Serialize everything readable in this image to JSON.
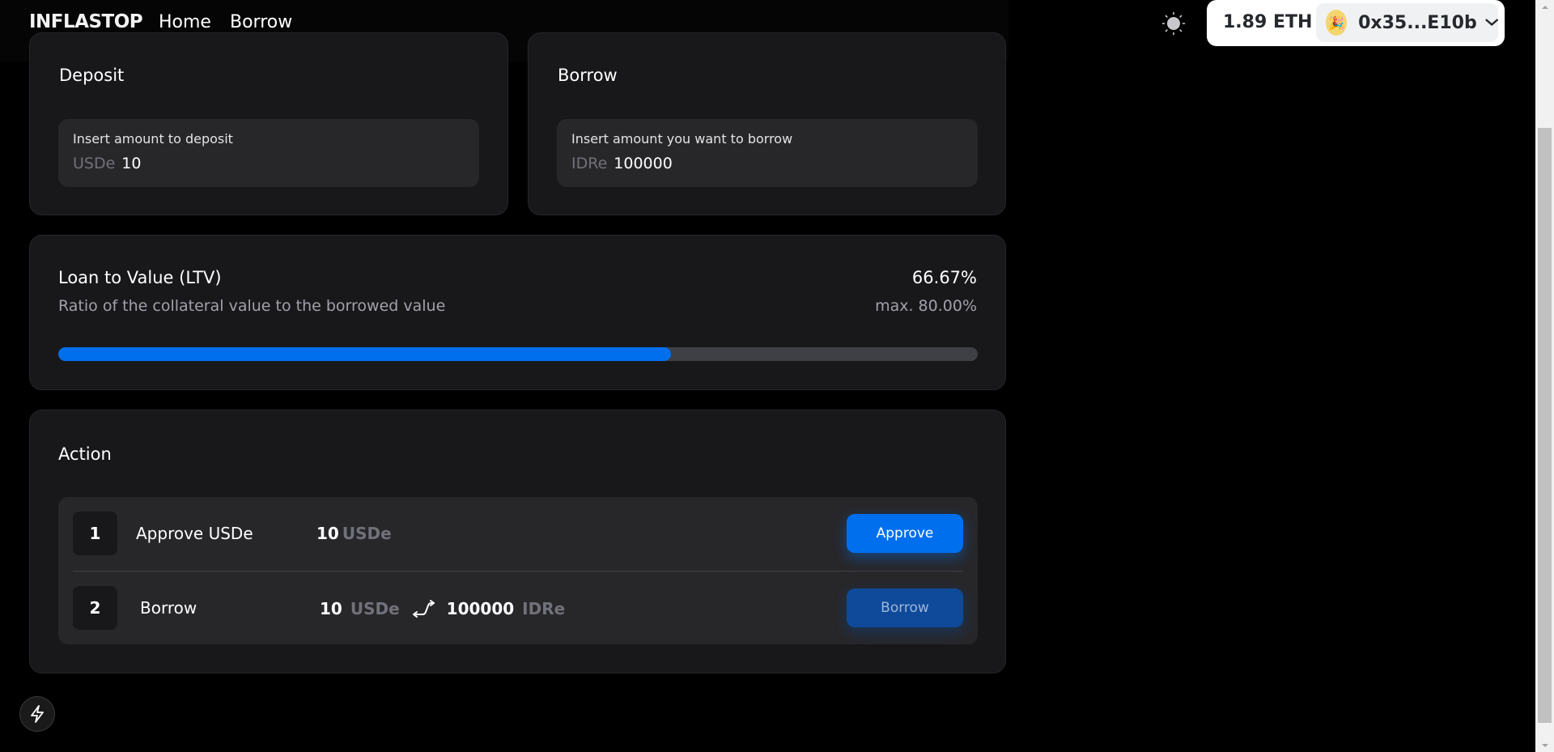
{
  "navbar": {
    "brand": "INFLASTOP",
    "links": [
      {
        "label": "Home"
      },
      {
        "label": "Borrow"
      }
    ]
  },
  "wallet": {
    "balance": "1.89 ETH",
    "address": "0x35...E10b",
    "avatar_emoji": "🎉"
  },
  "deposit": {
    "title": "Deposit",
    "label": "Insert amount to deposit",
    "unit": "USDe",
    "value": "10"
  },
  "borrow": {
    "title": "Borrow",
    "label": "Insert amount you want to borrow",
    "unit": "IDRe",
    "value": "100000"
  },
  "ltv": {
    "title": "Loan to Value (LTV)",
    "subtitle": "Ratio of the collateral value to the borrowed value",
    "value": "66.67%",
    "max": "max. 80.00%",
    "progress_fraction": 0.6667
  },
  "action": {
    "title": "Action",
    "steps": [
      {
        "num": "1",
        "label": "Approve USDe",
        "amount": "10",
        "unit": "USDe",
        "button": "Approve"
      },
      {
        "num": "2",
        "label": "Borrow",
        "from_amount": "10",
        "from_unit": "USDe",
        "to_amount": "100000",
        "to_unit": "IDRe",
        "button": "Borrow"
      }
    ]
  },
  "colors": {
    "accent": "#006fee",
    "card_bg": "#18181b",
    "input_bg": "#27272a"
  },
  "icons": [
    "sun-icon",
    "chevron-down-icon",
    "swap-icon",
    "bolt-icon"
  ]
}
